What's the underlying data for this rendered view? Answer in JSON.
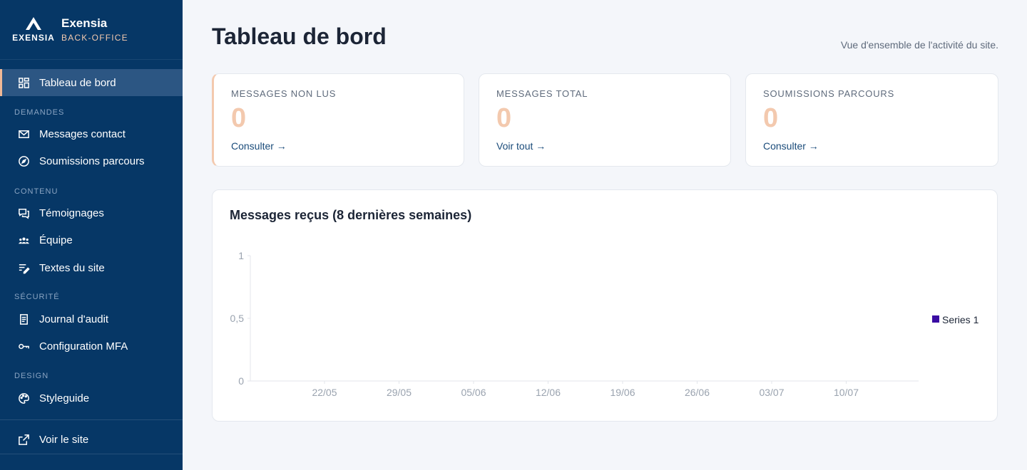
{
  "brand": {
    "logo_text": "EXENSIA",
    "name": "Exensia",
    "sub": "BACK-OFFICE"
  },
  "sidebar": {
    "items": [
      {
        "label": "Tableau de bord",
        "icon": "dashboard-icon"
      },
      {
        "label": "Messages contact",
        "icon": "mail-icon"
      },
      {
        "label": "Soumissions parcours",
        "icon": "compass-icon"
      },
      {
        "label": "Témoignages",
        "icon": "chat-bubbles-icon"
      },
      {
        "label": "Équipe",
        "icon": "group-icon"
      },
      {
        "label": "Textes du site",
        "icon": "edit-text-icon"
      },
      {
        "label": "Journal d'audit",
        "icon": "receipt-icon"
      },
      {
        "label": "Configuration MFA",
        "icon": "key-icon"
      },
      {
        "label": "Styleguide",
        "icon": "palette-icon"
      },
      {
        "label": "Voir le site",
        "icon": "external-link-icon"
      }
    ],
    "sections": [
      "DEMANDES",
      "CONTENU",
      "SÉCURITÉ",
      "DESIGN"
    ]
  },
  "header": {
    "title": "Tableau de bord",
    "subtitle": "Vue d'ensemble de l'activité du site."
  },
  "cards": [
    {
      "label": "MESSAGES NON LUS",
      "value": "0",
      "link": "Consulter →"
    },
    {
      "label": "MESSAGES TOTAL",
      "value": "0",
      "link": "Voir tout →"
    },
    {
      "label": "SOUMISSIONS PARCOURS",
      "value": "0",
      "link": "Consulter →"
    }
  ],
  "colors": {
    "sidebar": "#063766",
    "accent": "#f3c9ae",
    "series": "#3a0ca3"
  },
  "chart_data": {
    "type": "line",
    "title": "Messages reçus (8 dernières semaines)",
    "categories": [
      "22/05",
      "29/05",
      "05/06",
      "12/06",
      "19/06",
      "26/06",
      "03/07",
      "10/07"
    ],
    "series": [
      {
        "name": "Series 1",
        "values": [
          0,
          0,
          0,
          0,
          0,
          0,
          0,
          0
        ]
      }
    ],
    "yticks": [
      "0",
      "0,5",
      "1"
    ],
    "ylim": [
      0,
      1
    ],
    "grid": false,
    "legend": "right"
  }
}
